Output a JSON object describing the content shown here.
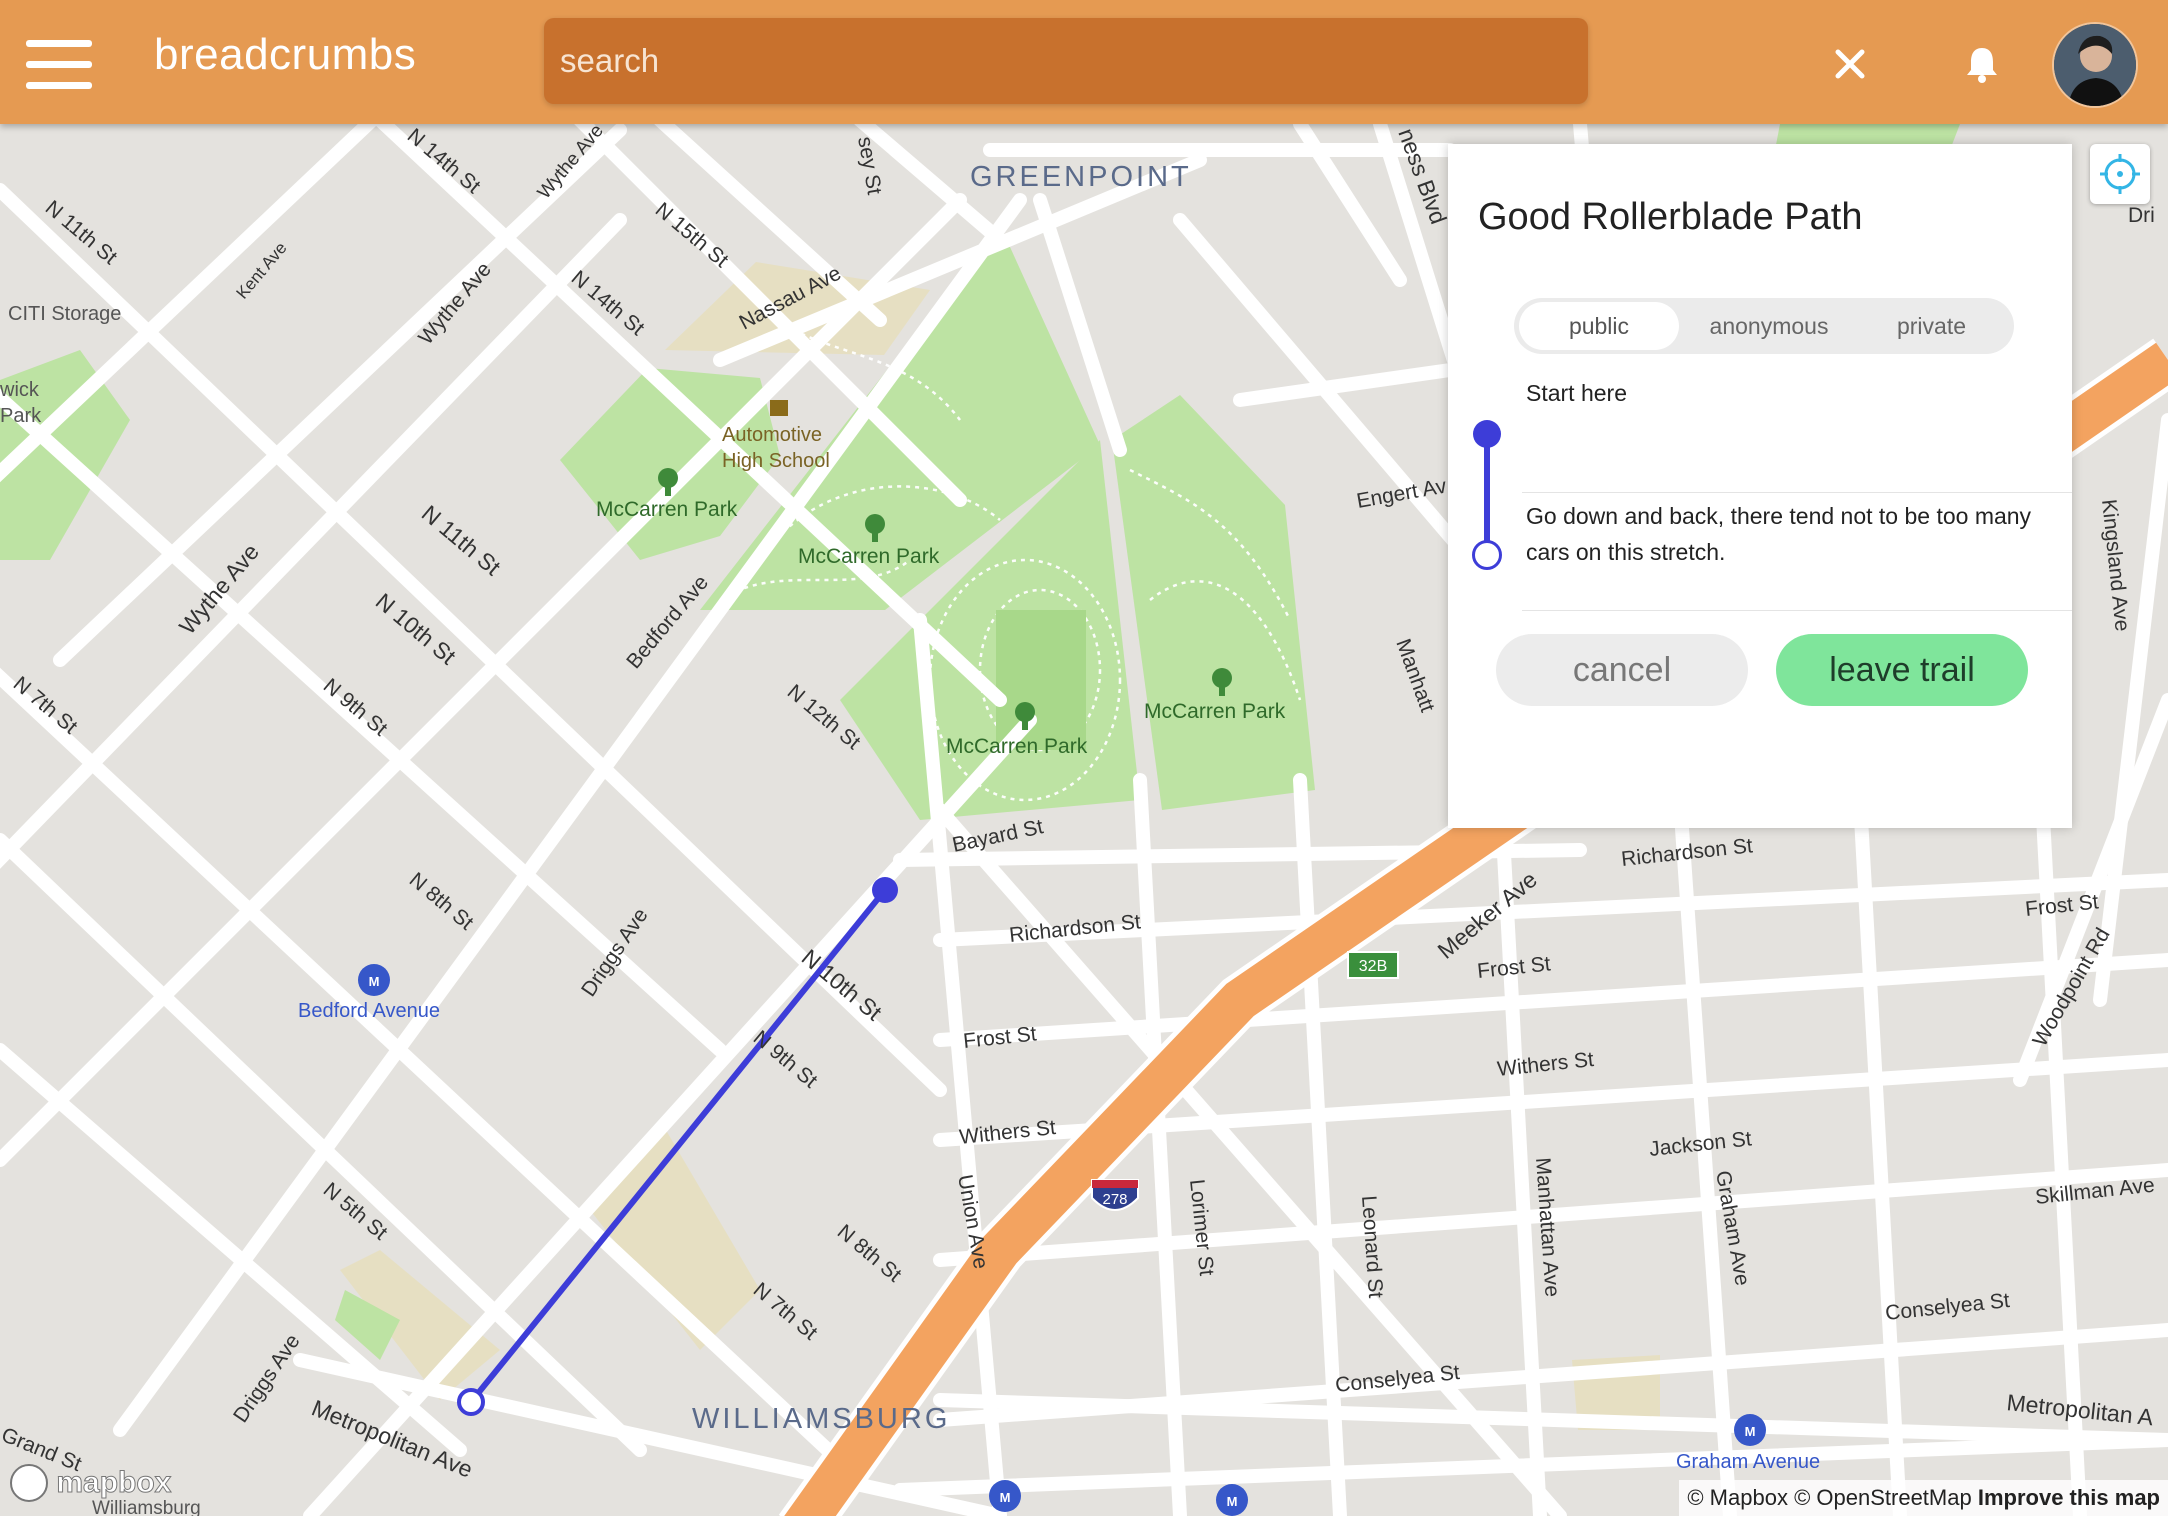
{
  "header": {
    "brand": "breadcrumbs",
    "search_placeholder": "search",
    "menu_icon": "hamburger-icon",
    "close_icon": "close-icon",
    "bell_icon": "bell-icon",
    "avatar_icon": "user-avatar"
  },
  "panel": {
    "title": "Good Rollerblade Path",
    "visibility_options": [
      "public",
      "anonymous",
      "private"
    ],
    "visibility_selected": "public",
    "steps": [
      "Start here",
      "Go down and back, there tend not to be too many cars on this stretch."
    ],
    "cancel_label": "cancel",
    "leave_label": "leave trail"
  },
  "map": {
    "neighborhoods": [
      "GREENPOINT",
      "WILLIAMSBURG"
    ],
    "parks": [
      "McCarren Park",
      "McCarren Park",
      "McCarren Park",
      "McCarren Park",
      "McCarren Park"
    ],
    "places": [
      "Automotive",
      "High School",
      "CITI Storage",
      "Bedford Avenue",
      "Graham Avenue",
      "Williamsburg",
      "wick",
      "Park"
    ],
    "streets": [
      "N 11th St",
      "Kent Ave",
      "N 14th St",
      "Wythe Ave",
      "N 15th St",
      "N 14th St",
      "Wythe Ave",
      "Nassau Ave",
      "sey St",
      "ness Blvd",
      "Engert Av",
      "Kingsland Ave",
      "N 11th St",
      "Wythe Ave",
      "Bedford Ave",
      "N 10th St",
      "N 9th St",
      "N 7th St",
      "N 12th St",
      "Bayard St",
      "Richardson St",
      "Richardson St",
      "Meeker Ave",
      "Frost St",
      "Frost St",
      "Frost St",
      "Driggs Ave",
      "N 8th St",
      "N 10th St",
      "N 9th St",
      "Withers St",
      "Withers St",
      "Jackson St",
      "Skillman Ave",
      "Woodpoint Rd",
      "Union Ave",
      "Lorimer St",
      "Leonard St",
      "Manhattan Ave",
      "Graham Ave",
      "N 8th St",
      "N 7th St",
      "N 5th St",
      "Driggs Ave",
      "Metropolitan Ave",
      "Metropolitan A",
      "Conselyea St",
      "Conselyea St",
      "Grand St",
      "Manhatt",
      "Dri",
      "Kent Ave"
    ],
    "shields": [
      "278",
      "32B"
    ],
    "attribution_mapbox": "© Mapbox",
    "attribution_osm": "© OpenStreetMap",
    "attribution_improve": "Improve this map",
    "logo": "mapbox",
    "locate_icon": "crosshair-icon"
  },
  "colors": {
    "header": "#e59a52",
    "search": "#c8712d",
    "trail": "#3d3dd8",
    "park": "#bde3a3",
    "highway": "#f3a360",
    "leave_button": "#7fe59b"
  }
}
